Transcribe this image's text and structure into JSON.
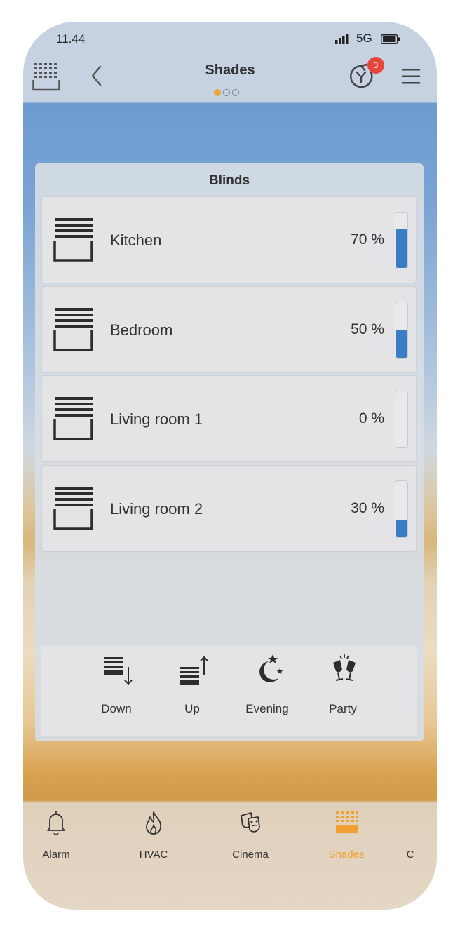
{
  "status": {
    "time": "11.44",
    "network": "5G"
  },
  "header": {
    "title": "Shades",
    "page_dots": 3,
    "active_dot": 0,
    "notification_count": "3"
  },
  "panel": {
    "title": "Blinds",
    "rows": [
      {
        "label": "Kitchen",
        "value": "70 %",
        "level": 0.7
      },
      {
        "label": "Bedroom",
        "value": "50 %",
        "level": 0.5
      },
      {
        "label": "Living room 1",
        "value": "0 %",
        "level": 0.0
      },
      {
        "label": "Living room 2",
        "value": "30 %",
        "level": 0.3
      }
    ]
  },
  "scenes": [
    {
      "label": "Down",
      "icon": "blinds-down-icon"
    },
    {
      "label": "Up",
      "icon": "blinds-up-icon"
    },
    {
      "label": "Evening",
      "icon": "moon-stars-icon"
    },
    {
      "label": "Party",
      "icon": "champagne-glasses-icon"
    }
  ],
  "tabs": [
    {
      "label": "Alarm",
      "icon": "bell-icon",
      "active": false
    },
    {
      "label": "HVAC",
      "icon": "flame-icon",
      "active": false
    },
    {
      "label": "Cinema",
      "icon": "theater-masks-icon",
      "active": false
    },
    {
      "label": "Shades",
      "icon": "shades-icon",
      "active": true
    },
    {
      "label": "C",
      "icon": "",
      "active": false
    }
  ],
  "colors": {
    "accent": "#f0a030",
    "slider_fill": "#3a7dc6",
    "badge": "#e8453c"
  }
}
